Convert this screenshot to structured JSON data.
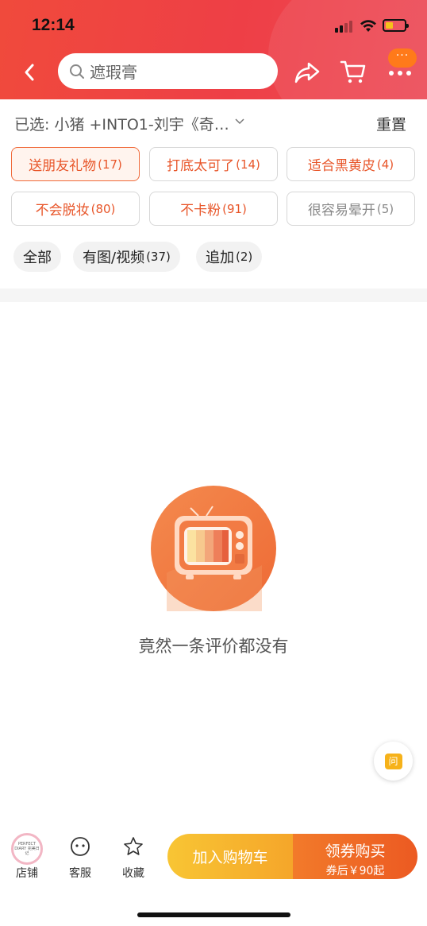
{
  "status_bar": {
    "time": "12:14"
  },
  "header": {
    "search": {
      "value": "遮瑕膏"
    },
    "msg_bubble": "···"
  },
  "selection": {
    "label": "已选: 小猪 +INTO1-刘宇《奇…",
    "reset": "重置"
  },
  "tags": [
    {
      "text": "送朋友礼物",
      "count": "(17)",
      "state": "active"
    },
    {
      "text": "打底太可了",
      "count": "(14)",
      "state": "normal"
    },
    {
      "text": "适合黑黄皮",
      "count": "(4)",
      "state": "normal"
    },
    {
      "text": "不会脱妆",
      "count": "(80)",
      "state": "normal"
    },
    {
      "text": "不卡粉",
      "count": "(91)",
      "state": "normal"
    },
    {
      "text": "很容易晕开",
      "count": "(5)",
      "state": "gray"
    }
  ],
  "filters": [
    {
      "text": "全部",
      "count": ""
    },
    {
      "text": "有图/视频",
      "count": "(37)"
    },
    {
      "text": "追加",
      "count": "(2)"
    }
  ],
  "empty_state": {
    "message": "竟然一条评价都没有",
    "icon": "tv-icon"
  },
  "ask_button": {
    "text": "问"
  },
  "bottom_bar": {
    "store": {
      "label": "店铺",
      "logo_text": "PERFECT DIARY 完美日记"
    },
    "service": {
      "label": "客服"
    },
    "favorite": {
      "label": "收藏"
    },
    "add_to_cart": "加入购物车",
    "buy": {
      "main": "领券购买",
      "sub": "券后￥90起"
    }
  },
  "colors": {
    "header_red": "#ee3f46",
    "accent_orange": "#e8562a",
    "cart_yellow": "#f8c534",
    "buy_orange": "#ec5a22"
  }
}
